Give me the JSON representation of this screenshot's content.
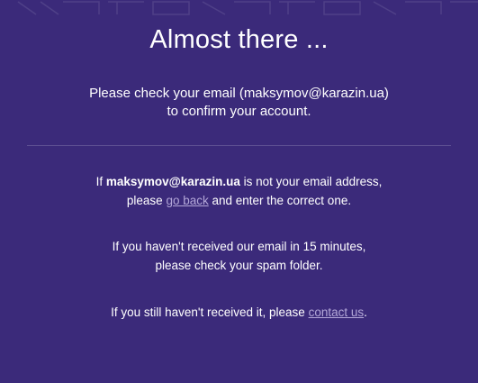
{
  "title": "Almost there ...",
  "instructions": {
    "line1": "Please check your email (maksymov@karazin.ua)",
    "line2": "to confirm your account."
  },
  "wrong_email": {
    "prefix": "If ",
    "email": "maksymov@karazin.ua",
    "suffix": " is not your email address,",
    "line2_prefix": "please ",
    "link": "go back",
    "line2_suffix": " and enter the correct one."
  },
  "spam": {
    "line1": "If you haven't received our email in 15 minutes,",
    "line2": "please check your spam folder."
  },
  "contact": {
    "prefix": "If you still haven't received it, please ",
    "link": "contact us",
    "suffix": "."
  },
  "colors": {
    "background": "#3b2a7a",
    "link": "#b3a7d8",
    "text": "#ffffff"
  }
}
